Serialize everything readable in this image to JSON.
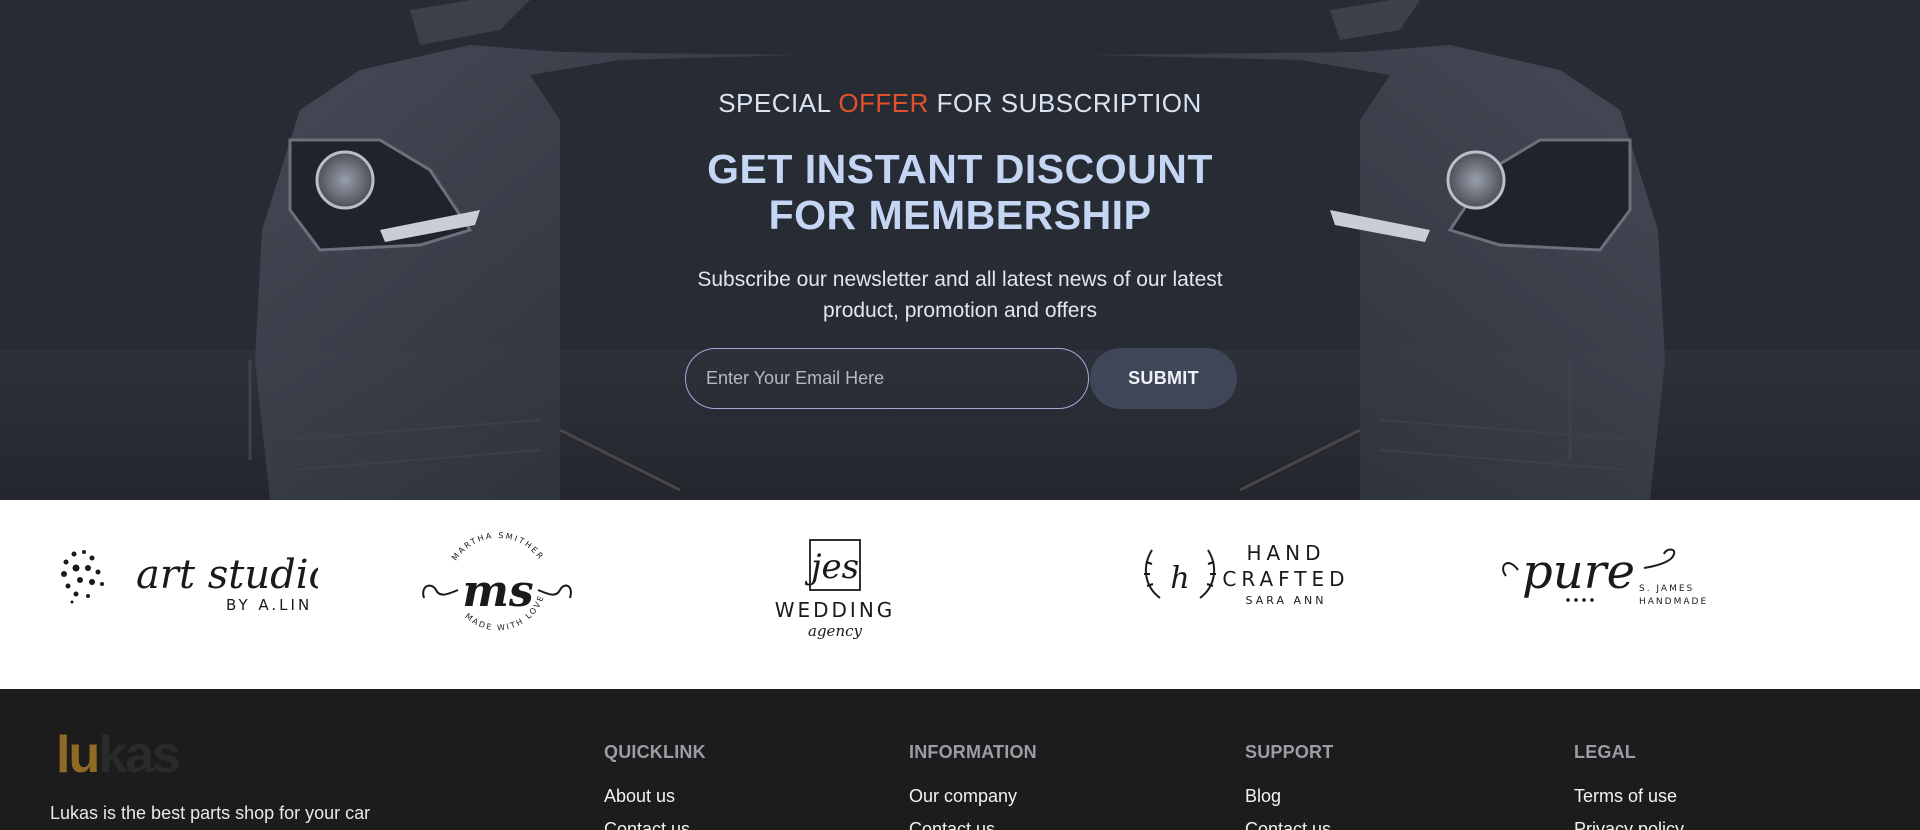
{
  "hero": {
    "offer_prefix": "SPECIAL",
    "offer_accent": "OFFER",
    "offer_suffix": "FOR SUBSCRIPTION",
    "headline": "GET INSTANT DISCOUNT FOR MEMBERSHIP",
    "subtext": "Subscribe our newsletter and all latest news of our latest product, promotion and offers",
    "email_placeholder": "Enter Your Email Here",
    "submit_label": "SUBMIT",
    "accent_color": "#e0522b"
  },
  "brands": [
    {
      "name": "art studio",
      "sub": "BY A.LIN"
    },
    {
      "initials": "ms",
      "top_ring": "MARTHA SMITHER",
      "bottom_ring": "MADE WITH LOVE"
    },
    {
      "initials": "jes",
      "name": "WEDDING",
      "sub": "agency"
    },
    {
      "initials": "h",
      "line1": "HAND",
      "line2": "CRAFTED",
      "sub": "SARA ANN"
    },
    {
      "name": "pure",
      "sub1": "S. JAMES",
      "sub2": "HANDMADE"
    }
  ],
  "footer": {
    "logo_first": "lu",
    "logo_rest": "kas",
    "tagline": "Lukas is the best parts shop for your car",
    "columns": [
      {
        "title": "QUICKLINK",
        "links": [
          "About us",
          "Contact us"
        ]
      },
      {
        "title": "INFORMATION",
        "links": [
          "Our company",
          "Contact us"
        ]
      },
      {
        "title": "SUPPORT",
        "links": [
          "Blog",
          "Contact us"
        ]
      },
      {
        "title": "LEGAL",
        "links": [
          "Terms of use",
          "Privacy policy"
        ]
      }
    ]
  }
}
